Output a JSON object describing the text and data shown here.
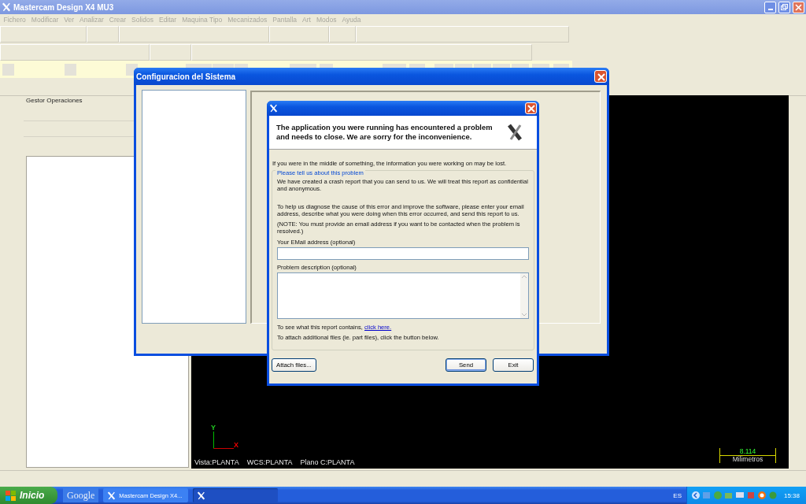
{
  "app": {
    "title": "Mastercam Design X4 MU3",
    "menu": [
      "Fichero",
      "Modificar",
      "Ver",
      "Analizar",
      "Crear",
      "Solidos",
      "Editar",
      "Maquina Tipo",
      "Mecanizados",
      "Pantalla",
      "Art",
      "Modos",
      "Ayuda"
    ],
    "panel_title": "Gestor Operaciones",
    "viewport": {
      "axis_y": "Y",
      "axis_x": "X",
      "status": [
        "Vista:PLANTA",
        "WCS:PLANTA",
        "Plano C:PLANTA"
      ],
      "scale_value": "8.114",
      "scale_unit": "Milimetros"
    }
  },
  "config_dialog": {
    "title": "Configuracion del Sistema"
  },
  "crash_dialog": {
    "heading": "The application you were running has encountered a problem and needs to close. We are sorry for the inconvenience.",
    "intro": "If you were in the middle of something, the information you were working on may be lost.",
    "group_title": "Please tell us about this problem",
    "paragraphs": [
      "We have created a crash report that you can send to us. We will treat this report as confidential and anonymous.",
      "To help us diagnose the cause of this error and improve the software, please enter your email address, describe what you were doing when this error occurred, and send this report to us.",
      "(NOTE: You must provide an email address if you want to be contacted when the problem is resolved.)"
    ],
    "email_label": "Your EMail address (optional)",
    "description_label": "Problem description (optional)",
    "view_report_text": "To see what this report contains,",
    "view_report_link": "click here.",
    "attach_text": "To attach additional files (ie. part files), click the button below.",
    "buttons": [
      {
        "label": "Attach files...",
        "kind": "normal"
      },
      {
        "label": "Send",
        "kind": "default"
      },
      {
        "label": "Exit",
        "kind": "normal"
      }
    ]
  },
  "taskbar": {
    "start": "Inicio",
    "quick_launch": "Google",
    "tasks": [
      {
        "label": "Mastercam Design X4...",
        "selected": false
      },
      {
        "selected": true
      }
    ],
    "language": "ES",
    "clock": "15:38"
  }
}
